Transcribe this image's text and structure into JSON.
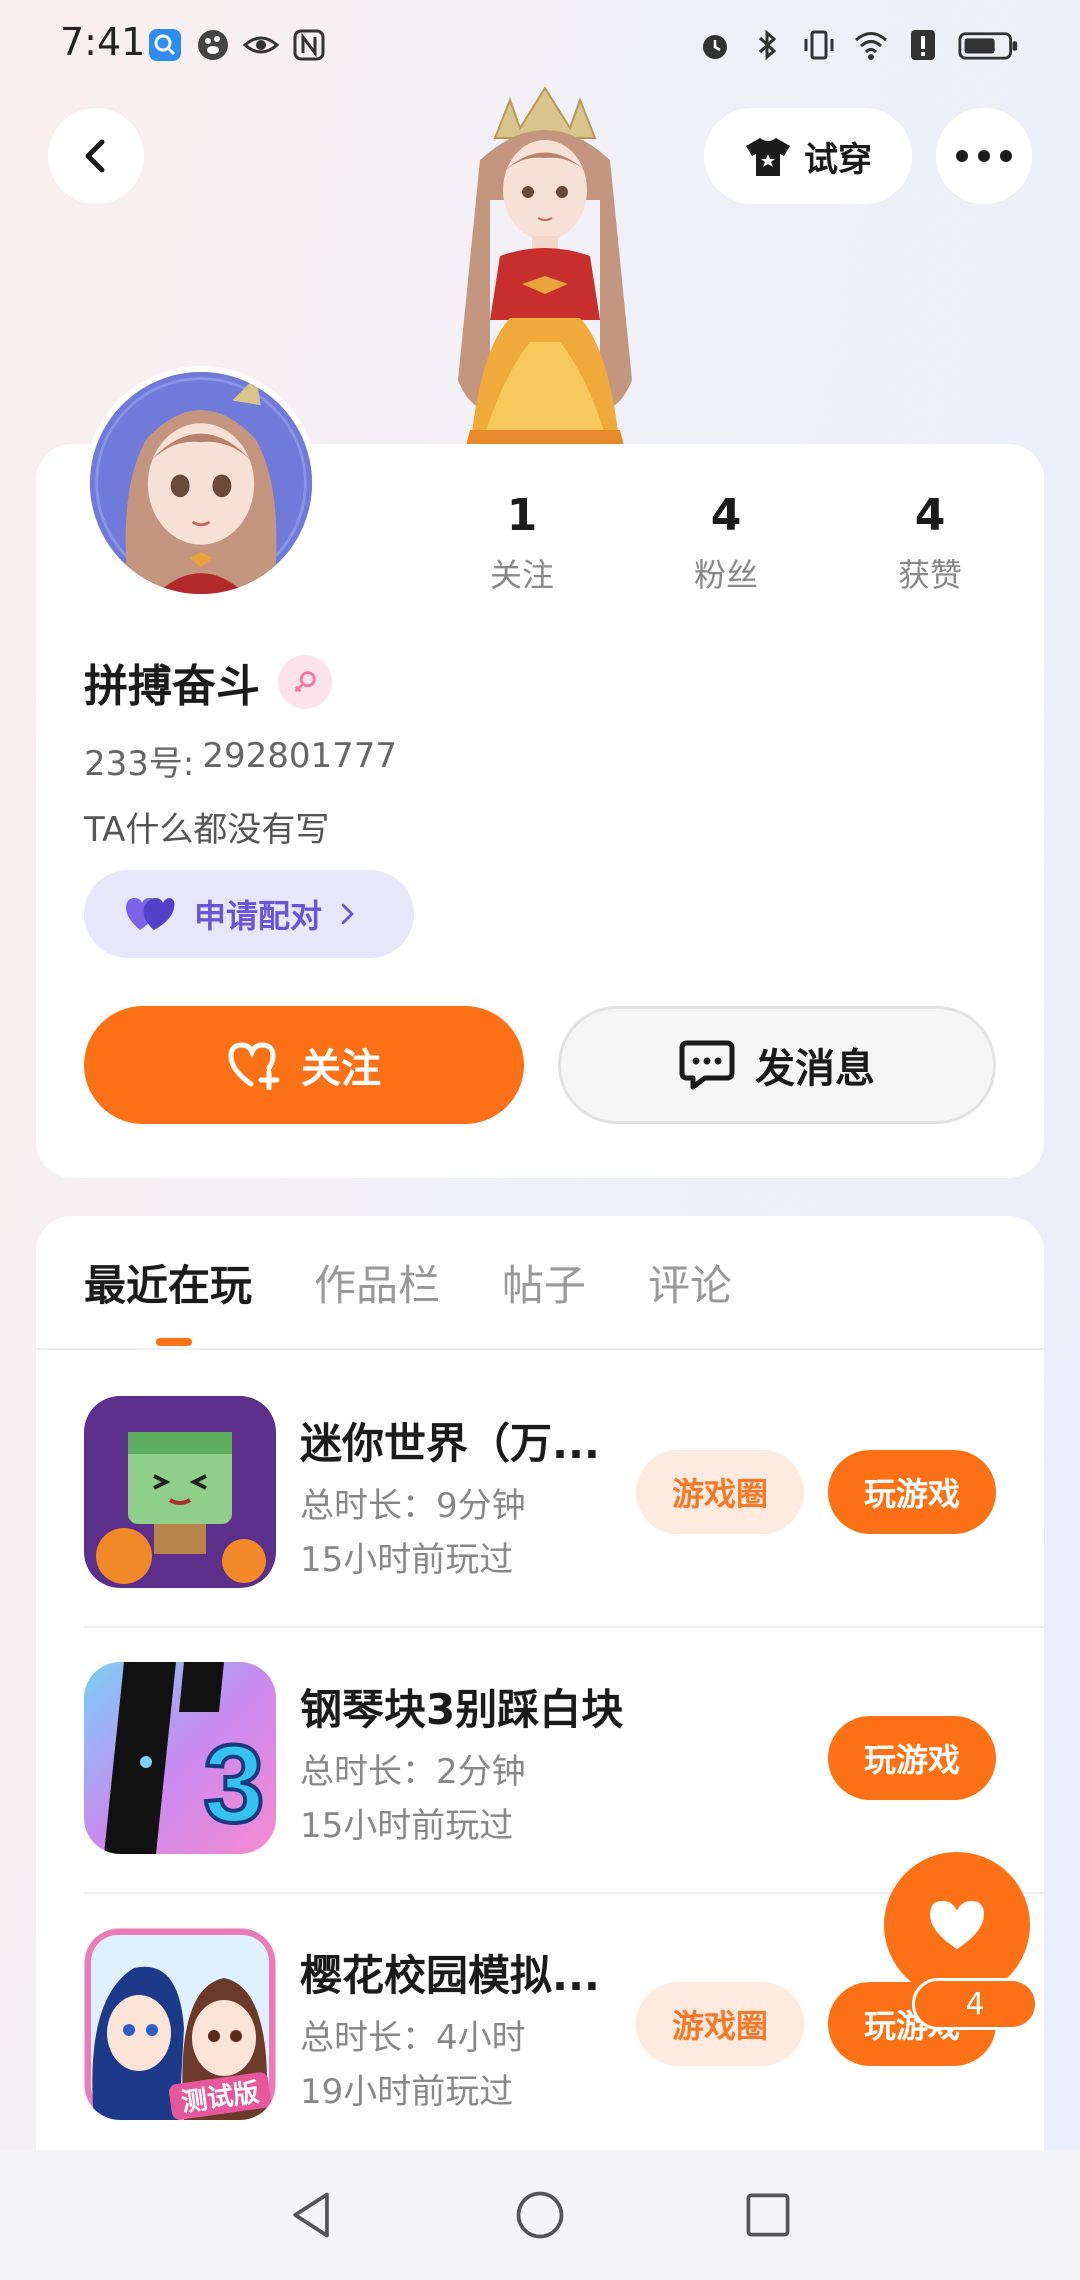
{
  "status_bar": {
    "time": "7:41",
    "left_icons": [
      "search-app-icon",
      "paw-app-icon",
      "eye-icon",
      "nfc-icon"
    ],
    "right_icons": [
      "alarm-icon",
      "bluetooth-icon",
      "vibrate-icon",
      "wifi-icon",
      "alert-icon",
      "battery-icon"
    ]
  },
  "topbar": {
    "try_on_label": "试穿"
  },
  "profile": {
    "username": "拼搏奋斗",
    "gender": "female",
    "uid_label": "233号:",
    "uid_value": "292801777",
    "bio": "TA什么都没有写",
    "pair_label": "申请配对",
    "stats": [
      {
        "value": "1",
        "label": "关注"
      },
      {
        "value": "4",
        "label": "粉丝"
      },
      {
        "value": "4",
        "label": "获赞"
      }
    ],
    "follow_label": "关注",
    "message_label": "发消息"
  },
  "tabs": [
    "最近在玩",
    "作品栏",
    "帖子",
    "评论"
  ],
  "active_tab": "最近在玩",
  "games": [
    {
      "name": "迷你世界（万...",
      "duration": "总时长：9分钟",
      "last_played": "15小时前玩过",
      "circle_label": "游戏圈",
      "play_label": "玩游戏"
    },
    {
      "name": "钢琴块3别踩白块",
      "duration": "总时长：2分钟",
      "last_played": "15小时前玩过",
      "play_label": "玩游戏"
    },
    {
      "name": "樱花校园模拟...",
      "duration": "总时长：4小时",
      "last_played": "19小时前玩过",
      "circle_label": "游戏圈",
      "play_label": "玩游戏"
    }
  ],
  "game_icon_texts": {
    "piano_number": "3",
    "sakura_badge": "测试版"
  },
  "like": {
    "count": "4"
  },
  "colors": {
    "accent": "#fc7115",
    "pair": "#6a55d8",
    "circle_pill_bg": "#feeadf"
  }
}
